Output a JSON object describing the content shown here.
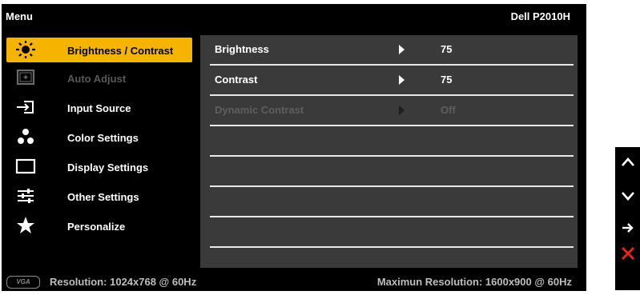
{
  "header": {
    "menu_title": "Menu",
    "model": "Dell P2010H"
  },
  "menu": {
    "items": [
      {
        "label": "Brightness / Contrast",
        "icon": "sun-icon",
        "selected": true,
        "enabled": true
      },
      {
        "label": "Auto Adjust",
        "icon": "auto-adjust-icon",
        "selected": false,
        "enabled": false
      },
      {
        "label": "Input Source",
        "icon": "input-source-icon",
        "selected": false,
        "enabled": true
      },
      {
        "label": "Color Settings",
        "icon": "color-dots-icon",
        "selected": false,
        "enabled": true
      },
      {
        "label": "Display Settings",
        "icon": "display-icon",
        "selected": false,
        "enabled": true
      },
      {
        "label": "Other Settings",
        "icon": "sliders-icon",
        "selected": false,
        "enabled": true
      },
      {
        "label": "Personalize",
        "icon": "star-icon",
        "selected": false,
        "enabled": true
      }
    ]
  },
  "settings": {
    "rows": [
      {
        "label": "Brightness",
        "value": "75",
        "enabled": true
      },
      {
        "label": "Contrast",
        "value": "75",
        "enabled": true
      },
      {
        "label": "Dynamic Contrast",
        "value": "Off",
        "enabled": false
      }
    ]
  },
  "footer": {
    "input_badge": "VGA",
    "resolution": "Resolution: 1024x768 @ 60Hz",
    "max_resolution": "Maximun Resolution: 1600x900 @ 60Hz"
  },
  "hardware_buttons": [
    "up-arrow-icon",
    "down-arrow-icon",
    "enter-arrow-icon",
    "exit-x-icon"
  ],
  "colors": {
    "selected_bg": "#f6b400",
    "panel_bg": "#3a3a3a",
    "exit_red": "#e8231b"
  }
}
